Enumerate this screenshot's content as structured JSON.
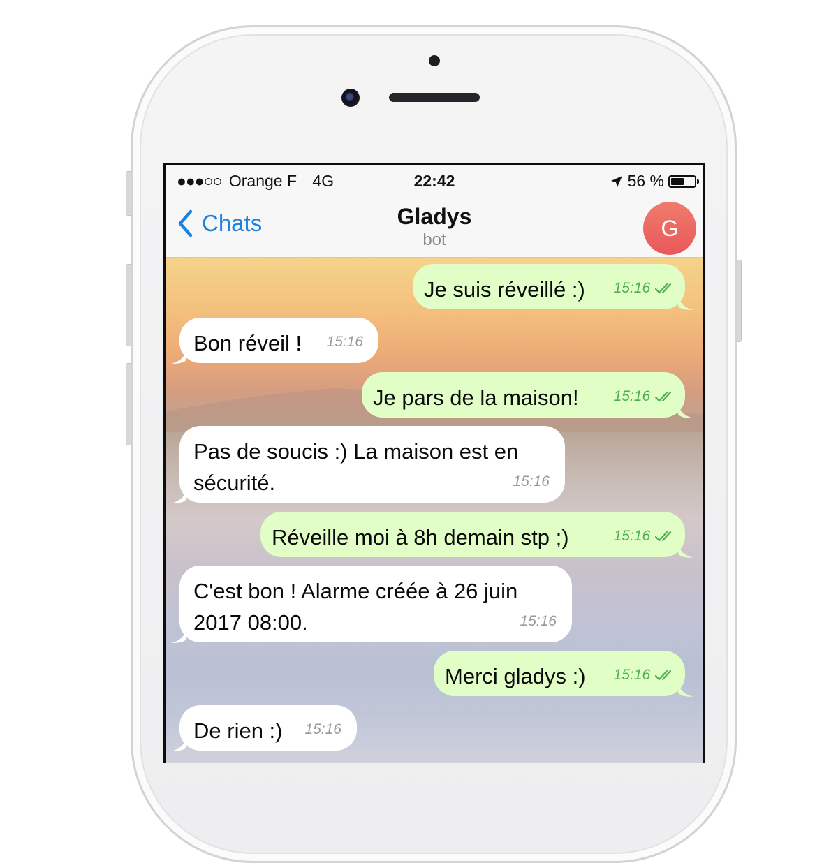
{
  "status_bar": {
    "signal": "●●●○○",
    "carrier": "Orange F",
    "network": "4G",
    "time": "22:42",
    "location_icon": "location-arrow-icon",
    "battery_text": "56 %",
    "battery_level": 0.56
  },
  "nav": {
    "back_label": "Chats",
    "title": "Gladys",
    "subtitle": "bot",
    "avatar_letter": "G",
    "avatar_color": "#e9625d",
    "accent_color": "#1a82e0"
  },
  "messages": [
    {
      "dir": "out",
      "text": "Je suis réveillé :)",
      "time": "15:16",
      "read": true
    },
    {
      "dir": "in",
      "text": "Bon réveil !",
      "time": "15:16"
    },
    {
      "dir": "out",
      "text": "Je pars de la maison!",
      "time": "15:16",
      "read": true
    },
    {
      "dir": "in",
      "text_line1": "Pas de soucis :) La maison est en",
      "text_line2": "sécurité.",
      "time": "15:16"
    },
    {
      "dir": "out",
      "text": "Réveille moi à 8h demain stp ;)",
      "time": "15:16",
      "read": true
    },
    {
      "dir": "in",
      "text_line1": "C'est bon ! Alarme créée à 26 juin",
      "text_line2": "2017 08:00.",
      "time": "15:16"
    },
    {
      "dir": "out",
      "text": "Merci gladys :)",
      "time": "15:16",
      "read": true
    },
    {
      "dir": "in",
      "text": "De rien :)",
      "time": "15:16"
    }
  ],
  "colors": {
    "outgoing_bubble": "#e1fec6",
    "incoming_bubble": "#ffffff",
    "read_ticks": "#4fae4e"
  }
}
